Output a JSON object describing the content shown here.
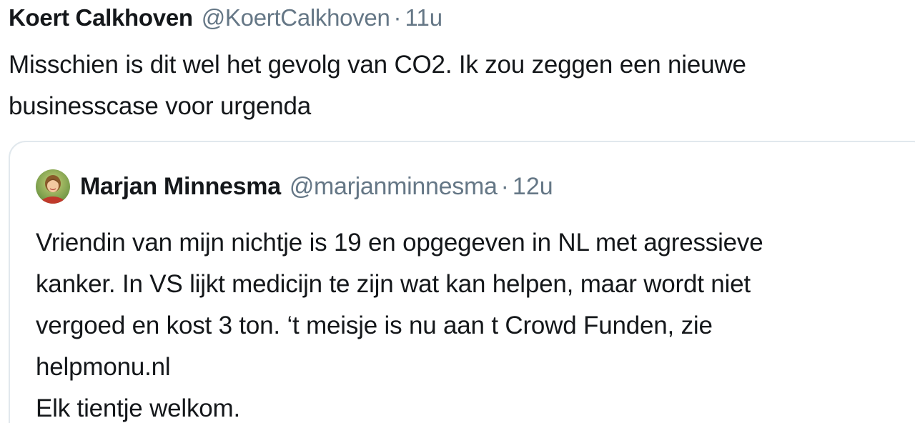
{
  "tweet": {
    "author_name": "Koert Calkhoven",
    "author_handle": "@KoertCalkhoven",
    "separator": "·",
    "time": "11u",
    "text_lines": [
      "Misschien is dit wel het gevolg van CO2. Ik zou zeggen een nieuwe",
      "businesscase voor urgenda"
    ]
  },
  "quoted_tweet": {
    "avatar_icon": "profile-photo",
    "author_name": "Marjan Minnesma",
    "author_handle": "@marjanminnesma",
    "separator": "·",
    "time": "12u",
    "text_lines": [
      "Vriendin van mijn nichtje is 19 en opgegeven in NL met agressieve",
      "kanker. In VS lijkt medicijn te zijn wat kan helpen, maar wordt niet",
      "vergoed en kost 3 ton. ‘t meisje is nu aan t Crowd Funden, zie",
      "helpmonu.nl",
      "Elk tientje welkom."
    ]
  },
  "colors": {
    "text": "#14171a",
    "secondary": "#657786",
    "border": "#e1e8ed"
  }
}
